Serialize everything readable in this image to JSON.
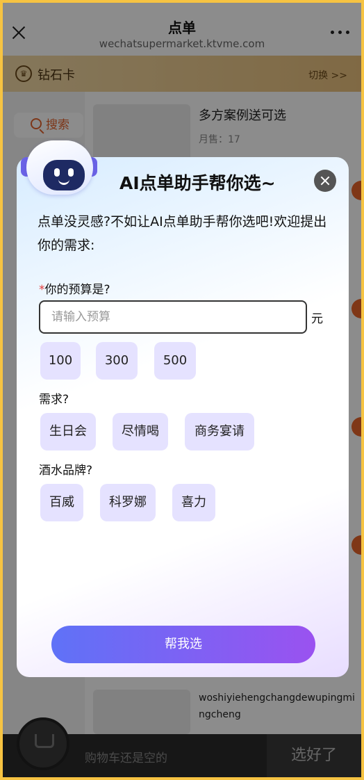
{
  "header": {
    "title": "点单",
    "url": "wechatsupermarket.ktvme.com"
  },
  "membership": {
    "label": "钻石卡",
    "switch": "切换 >>"
  },
  "sidebar": {
    "search": "搜索"
  },
  "products": [
    {
      "name": "多方案例送可选",
      "sales": "月售：17"
    },
    {
      "name": "woshiyiehengchangdewupingmingcheng"
    }
  ],
  "cart": {
    "empty_text": "购物车还是空的",
    "checkout": "选好了"
  },
  "dialog": {
    "title": "AI点单助手帮你选~",
    "intro": "点单没灵感?不如让AI点单助手帮你选吧!欢迎提出你的需求:",
    "budget": {
      "required_mark": "*",
      "label": "你的预算是?",
      "placeholder": "请输入预算",
      "unit": "元",
      "options": [
        "100",
        "300",
        "500"
      ]
    },
    "needs": {
      "label": "需求?",
      "options": [
        "生日会",
        "尽情喝",
        "商务宴请"
      ]
    },
    "brand": {
      "label": "酒水品牌?",
      "options": [
        "百威",
        "科罗娜",
        "喜力"
      ]
    },
    "submit": "帮我选"
  },
  "colors": {
    "accent_gradient_start": "#5f72f7",
    "accent_gradient_end": "#9a52f0",
    "chip_bg": "#e5e2ff",
    "search_orange": "#e4632d"
  }
}
